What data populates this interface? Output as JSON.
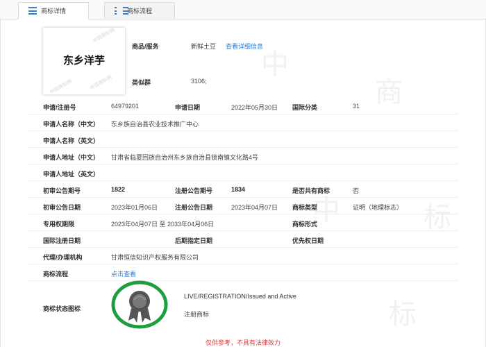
{
  "tabs": {
    "detail": "商标详情",
    "flow": "商标流程"
  },
  "logo": {
    "text": "东乡洋芋"
  },
  "goods": {
    "label": "商品/服务",
    "value": "新鲜土豆",
    "link": "查看详细信息"
  },
  "similar_group": {
    "label": "类似群",
    "value": "3106;"
  },
  "fields": {
    "reg_no_label": "申请/注册号",
    "reg_no": "64979201",
    "apply_date_label": "申请日期",
    "apply_date": "2022年05月30日",
    "intl_class_label": "国际分类",
    "intl_class": "31",
    "applicant_cn_label": "申请人名称（中文）",
    "applicant_cn": "东乡族自治县农业技术推广中心",
    "applicant_en_label": "申请人名称（英文）",
    "address_cn_label": "申请人地址（中文）",
    "address_cn": "甘肃省临夏回族自治州东乡族自治县锁南镇文化路4号",
    "address_en_label": "申请人地址（英文）",
    "prelim_no_label": "初审公告期号",
    "prelim_no": "1822",
    "reg_pub_no_label": "注册公告期号",
    "reg_pub_no": "1834",
    "shared_label": "是否共有商标",
    "shared": "否",
    "prelim_date_label": "初审公告日期",
    "prelim_date": "2023年01月06日",
    "reg_pub_date_label": "注册公告日期",
    "reg_pub_date": "2023年04月07日",
    "mark_type_label": "商标类型",
    "mark_type": "证明（地理标志）",
    "exclusive_period_label": "专用权期限",
    "exclusive_period": "2023年04月07日 至 2033年04月06日",
    "mark_form_label": "商标形式",
    "intl_reg_date_label": "国际注册日期",
    "later_designation_label": "后期指定日期",
    "priority_date_label": "优先权日期",
    "agent_label": "代理/办理机构",
    "agent": "甘肃恒信知识产权服务有限公司",
    "flow_label": "商标流程",
    "flow_link": "点击查看",
    "status_icon_label": "商标状态图标"
  },
  "status": {
    "english": "LIVE/REGISTRATION/Issued and Active",
    "chinese": "注册商标"
  },
  "disclaimer": "仅供参考，不具有法律效力",
  "colors": {
    "link": "#2a7fd6",
    "badge_ring": "#1f9e3f",
    "badge_seal": "#555555",
    "disclaimer": "#e03a3a"
  }
}
